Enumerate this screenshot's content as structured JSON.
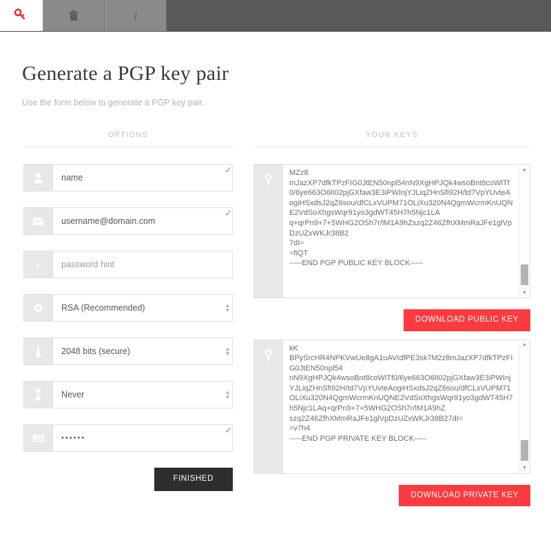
{
  "navbar": {
    "brand_icon": "key-icon",
    "tabs": [
      {
        "name": "trash-tab",
        "icon": "trash-icon"
      },
      {
        "name": "info-tab",
        "icon": "info-icon"
      }
    ]
  },
  "page": {
    "title": "Generate a PGP key pair",
    "subtitle": "Use the form below to generate a PGP key pair."
  },
  "options": {
    "heading": "OPTIONS",
    "fields": [
      {
        "icon": "user-icon",
        "value": "name",
        "placeholder": "name",
        "valid": "✓"
      },
      {
        "icon": "envelope-icon",
        "value": "username@domain.com",
        "placeholder": "username@domain.com",
        "valid": "✓"
      },
      {
        "icon": "info-icon",
        "value": "",
        "placeholder": "password hint",
        "valid": ""
      },
      {
        "icon": "gear-icon",
        "value": "RSA (Recommended)",
        "placeholder": "",
        "valid": ""
      },
      {
        "icon": "thermometer-icon",
        "value": "2048 bits (secure)",
        "placeholder": "",
        "valid": ""
      },
      {
        "icon": "hourglass-icon",
        "value": "Never",
        "placeholder": "",
        "valid": ""
      },
      {
        "icon": "keyboard-icon",
        "value": "••••••",
        "placeholder": "",
        "valid": "✓"
      }
    ],
    "finished_label": "FINISHED"
  },
  "keys": {
    "heading": "YOUR KEYS",
    "public": {
      "icon": "key-icon",
      "text": "MZz8\nmJazXP7dfkTPzFIG0JtEN50npl54nN9XgHPJQk4wsoBnt8coWlTf0/6ye663O6lI02pjGXfaw3E3iPWInjYJLiqZHnSfi92H/td7VpYUvteAogiHSxdsJ2qZ6sou/dfCLxVUPM71OLiXu320N4QgmWcrmKnUQNE2VdSoXhgsWqr91yo3gdWT45H7h5Njc1LA\nq+qrPn9+7+5WHG2OSh7r/lM1A9hZszq2Z46ZfhXMmRaJFe1glVpDzUZxWKJr38B2\n7dI=\n=fiQT\n-----END PGP PUBLIC KEY BLOCK-----",
      "download_label": "DOWNLOAD PUBLIC KEY",
      "scroll_up": "▲",
      "scroll_down": "▼"
    },
    "private": {
      "icon": "key-icon",
      "text": "kK\nBPySrcHR4NPKVwUe8gA1uAVIdfPE3sk7M2z8mJazXP7dfkTPzFIG0JtEN50npl54\nnN9XgHPJQk4wsoBnt8coWlTf0/6ye663O6lI02pjGXfaw3E3iPWInjYJLiqZHnSfi92H/td7VpYUvteAogiHSxdsJ2qZ6sou/dfCLxVUPM71OLiXu320N4QgmWcrmKnUQNE2VdSoXhgsWqr91yo3gdWT45H7h5Njc1LAq+qrPn9+7+5WHG2OSh7r/lM1A9hZ\nszq2Z46ZfhXMmRaJFe1glVpDzUZxWKJr38B27dI=\n=v7h4\n-----END PGP PRIVATE KEY BLOCK-----",
      "download_label": "DOWNLOAD PRIVATE KEY",
      "scroll_up": "▲",
      "scroll_down": "▼"
    }
  },
  "colors": {
    "accent_red": "#fb3b40",
    "brand_red": "#ee2222",
    "dark_button": "#2e2e2e",
    "navbar": "#595959"
  }
}
